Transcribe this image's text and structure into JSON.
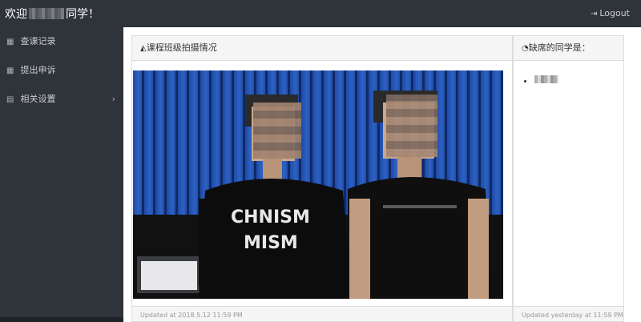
{
  "header": {
    "welcome_prefix": "欢迎",
    "welcome_suffix": "同学！",
    "logout_label": "Logout",
    "logout_icon": "sign-out-icon"
  },
  "sidebar": {
    "items": [
      {
        "label": "查课记录",
        "icon": "table-icon"
      },
      {
        "label": "提出申诉",
        "icon": "table-icon"
      },
      {
        "label": "相关设置",
        "icon": "file-icon",
        "has_submenu": true
      }
    ]
  },
  "panels": {
    "photo_panel": {
      "title": "课程班级拍摄情况",
      "icon": "area-chart-icon",
      "footer": "Updated at 2018.5.12 11:59 PM"
    },
    "absent_panel": {
      "title": "缺席的同学是：",
      "icon": "pie-chart-icon",
      "footer": "Updated yesterday at 11:59 PM"
    }
  },
  "colors": {
    "topbar": "#2f343a",
    "sidebar": "#2f343a",
    "panel_heading": "#f5f5f5",
    "border": "#dcdcdc"
  }
}
